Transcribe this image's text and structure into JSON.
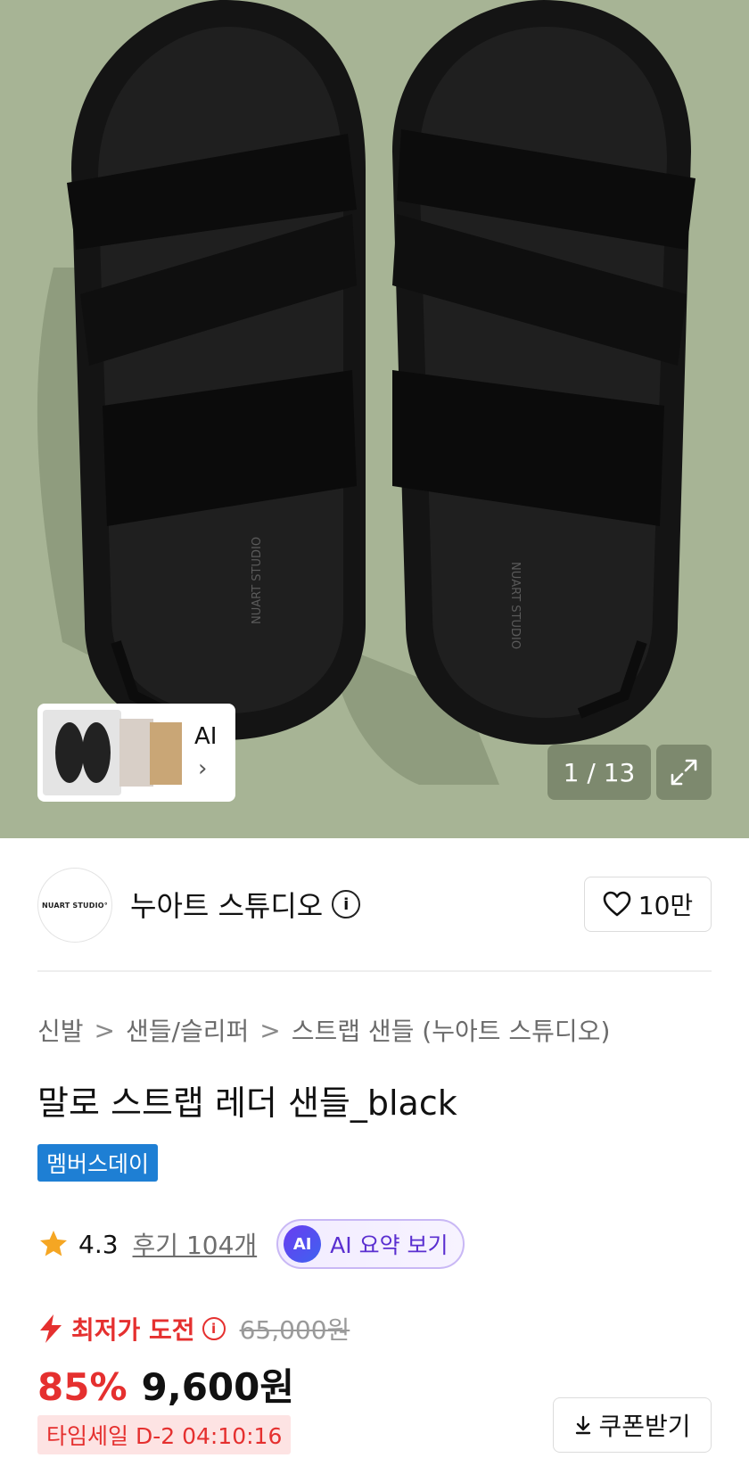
{
  "gallery": {
    "counter": "1 / 13",
    "ai_label": "AI",
    "ai_chevron": "›",
    "shoe_print": "NUART STUDIO"
  },
  "brand": {
    "logo_text": "NUART STUDIO°",
    "name": "누아트 스튜디오",
    "info_glyph": "i",
    "like_count": "10만"
  },
  "breadcrumb": {
    "items": [
      "신발",
      "샌들/슬리퍼",
      "스트랩 샌들 (누아트 스튜디오)"
    ],
    "separator": ">"
  },
  "product": {
    "title": "말로 스트랩 레더 샌들_black",
    "badge": "멤버스데이"
  },
  "rating": {
    "value": "4.3",
    "reviews": "후기 104개",
    "ai_badge": "AI",
    "ai_summary": "AI 요약 보기"
  },
  "price": {
    "lowest_label": "최저가 도전",
    "info_glyph": "i",
    "original": "65,000원",
    "discount": "85%",
    "final": "9,600원",
    "timesale": "타임세일 D-2 04:10:16",
    "coupon": "쿠폰받기"
  },
  "colors": {
    "accent_red": "#e5302f",
    "badge_blue": "#1e7fd4",
    "ai_purple": "#5a2fd0",
    "star": "#f5a623",
    "hero_bg": "#a7b495"
  }
}
